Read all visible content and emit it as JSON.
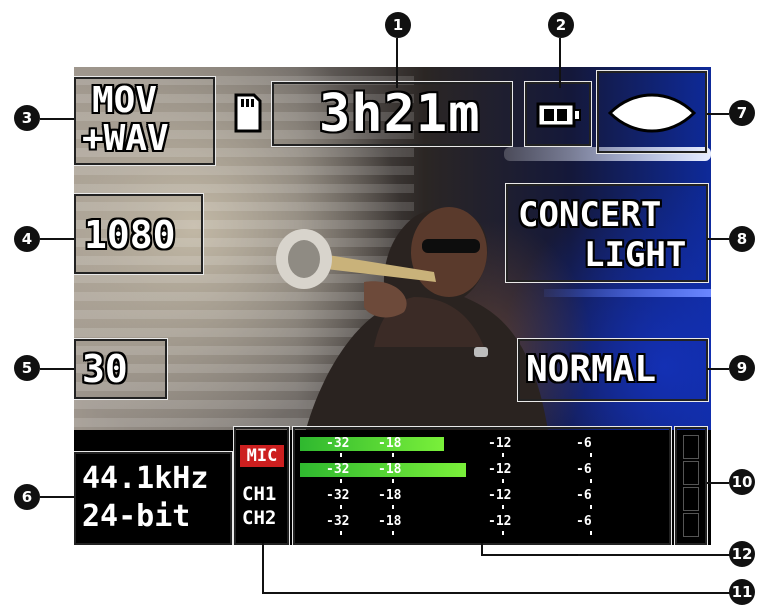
{
  "screen": {
    "remaining_time": "3h21m",
    "file_format": [
      "MOV",
      "+WAV"
    ],
    "resolution": "1080",
    "frame_rate": "30",
    "audio_format": [
      "44.1kHz",
      "24-bit"
    ],
    "scene": [
      "CONCERT",
      "LIGHT"
    ],
    "mode": "NORMAL",
    "input_labels": {
      "mic": "MIC",
      "ch1": "CH1",
      "ch2": "CH2"
    },
    "meters": {
      "scale_labels": [
        "-32",
        "-18",
        "-12",
        "-6"
      ],
      "rows": [
        {
          "name": "mic-l",
          "level": 0.39
        },
        {
          "name": "mic-r",
          "level": 0.45
        },
        {
          "name": "ch1",
          "level": 0
        },
        {
          "name": "ch2",
          "level": 0
        }
      ]
    },
    "icons": {
      "sd_card": "sd-card-icon",
      "battery": "battery-icon",
      "white_balance": "white-balance-icon"
    },
    "colors": {
      "meter": "#5fe03a",
      "mic_badge": "#cc1f1f",
      "callout": "#111111"
    }
  },
  "callouts": [
    "1",
    "2",
    "3",
    "4",
    "5",
    "6",
    "7",
    "8",
    "9",
    "10",
    "11",
    "12"
  ]
}
